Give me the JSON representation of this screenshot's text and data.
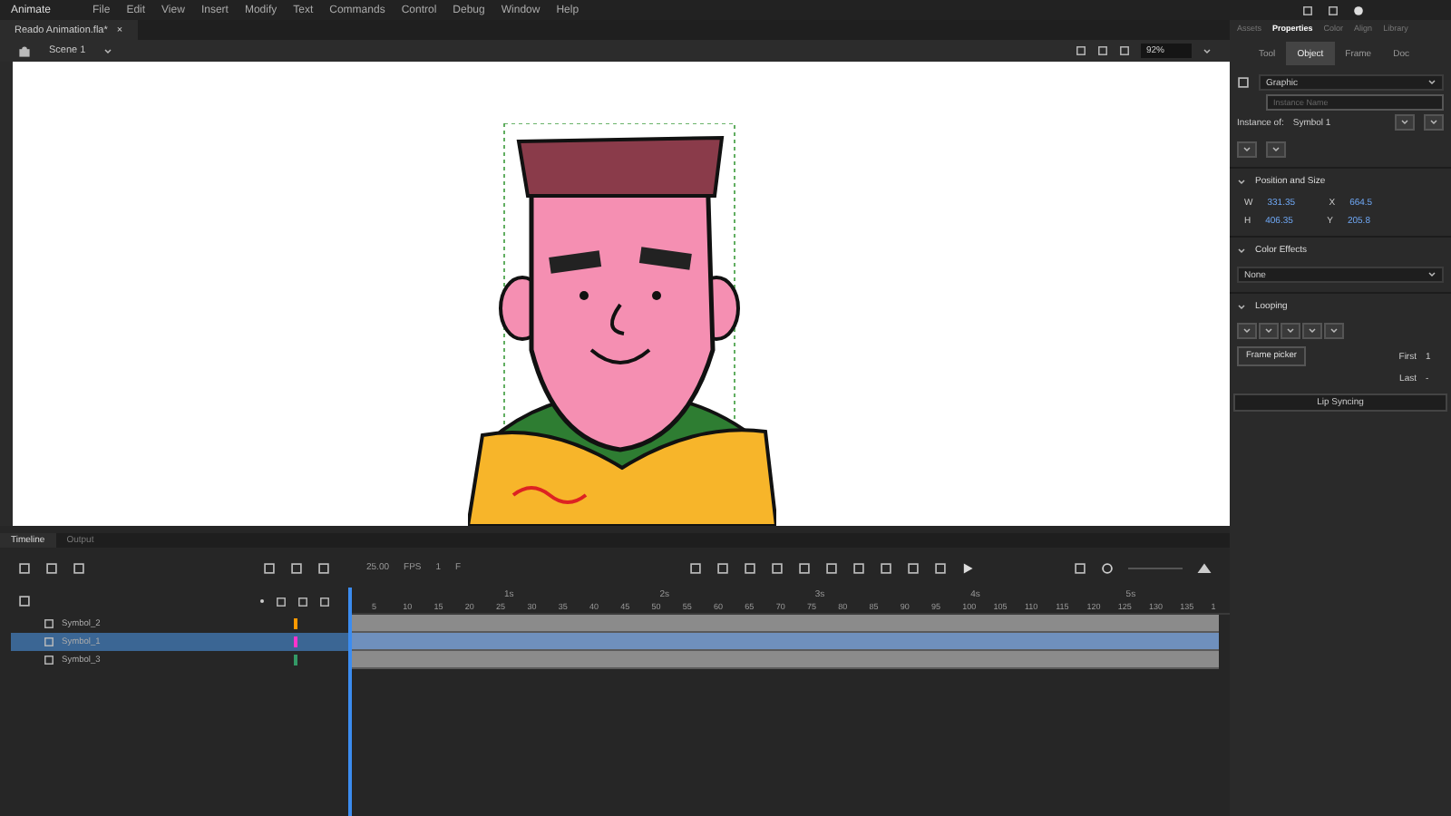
{
  "menu": [
    "Animate",
    "File",
    "Edit",
    "View",
    "Insert",
    "Modify",
    "Text",
    "Commands",
    "Control",
    "Debug",
    "Window",
    "Help"
  ],
  "document_tab": {
    "title": "Reado Animation.fla*",
    "close": "×"
  },
  "scene": {
    "label": "Scene 1",
    "zoom": "92%"
  },
  "timeline": {
    "tabs": [
      {
        "label": "Timeline",
        "selected": true
      },
      {
        "label": "Output",
        "selected": false
      }
    ],
    "fps": "25.00",
    "fps_unit": "FPS",
    "frame": "1",
    "frame_unit": "F",
    "seconds": [
      "1s",
      "2s",
      "3s",
      "4s",
      "5s"
    ],
    "frames": [
      "5",
      "10",
      "15",
      "20",
      "25",
      "30",
      "35",
      "40",
      "45",
      "50",
      "55",
      "60",
      "65",
      "70",
      "75",
      "80",
      "85",
      "90",
      "95",
      "100",
      "105",
      "110",
      "115",
      "120",
      "125",
      "130",
      "135",
      "1"
    ],
    "layers": [
      {
        "name": "Symbol_2",
        "selected": false,
        "color": "#ff9900"
      },
      {
        "name": "Symbol_1",
        "selected": true,
        "color": "#ff33cc"
      },
      {
        "name": "Symbol_3",
        "selected": false,
        "color": "#339966"
      }
    ]
  },
  "panel": {
    "tabs": [
      {
        "label": "Assets",
        "selected": false
      },
      {
        "label": "Properties",
        "selected": true
      },
      {
        "label": "Color",
        "selected": false
      },
      {
        "label": "Align",
        "selected": false
      },
      {
        "label": "Library",
        "selected": false
      }
    ],
    "subtabs": [
      {
        "label": "Tool",
        "selected": false
      },
      {
        "label": "Object",
        "selected": true
      },
      {
        "label": "Frame",
        "selected": false
      },
      {
        "label": "Doc",
        "selected": false
      }
    ],
    "symbol_type": "Graphic",
    "instance_placeholder": "Instance Name",
    "instance_of_label": "Instance of:",
    "instance_of": "Symbol 1",
    "position_title": "Position and Size",
    "fields": [
      {
        "label": "W",
        "value": "331.35"
      },
      {
        "label": "X",
        "value": "664.5"
      },
      {
        "label": "H",
        "value": "406.35"
      },
      {
        "label": "Y",
        "value": "205.8"
      }
    ],
    "color_effects_title": "Color Effects",
    "color_effect": "None",
    "looping_title": "Looping",
    "tooltip": "Frame picker",
    "first_label": "First",
    "first": "1",
    "last_label": "Last",
    "last": "-",
    "lip_sync": "Lip Syncing"
  }
}
